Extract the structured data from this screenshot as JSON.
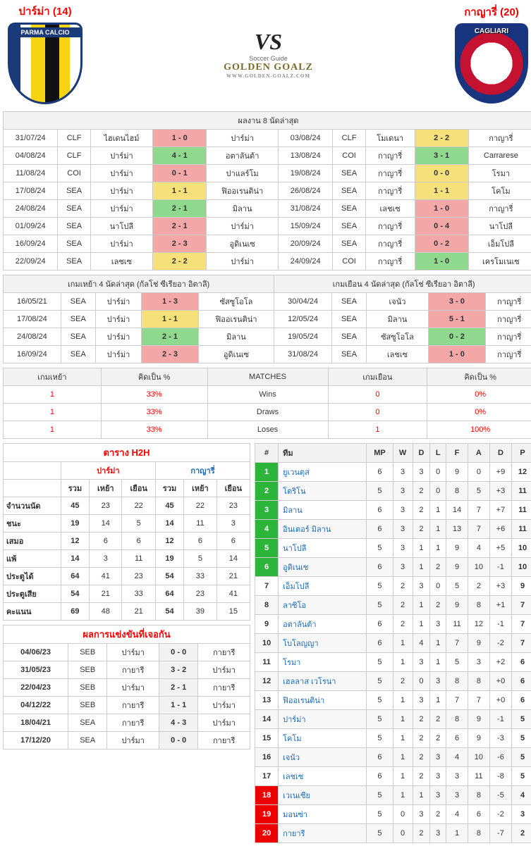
{
  "header": {
    "home": "ปาร์ม่า (14)",
    "away": "กาญารี่ (20)",
    "vs": "VS",
    "brand": "GOLDEN GOALZ",
    "brand_sub": "WWW.GOLDEN-GOALZ.COM",
    "brand_tag": "Soccer Guide",
    "parma_label": "PARMA CALCIO",
    "cagliari_label": "CAGLIARI"
  },
  "last8": {
    "title": "ผลงาน 8 นัดล่าสุด",
    "home": [
      {
        "d": "31/07/24",
        "c": "CLF",
        "h": "ไฮเดนไฮม์",
        "s": "1 - 0",
        "cls": "bg-red",
        "a": "ปาร์ม่า"
      },
      {
        "d": "04/08/24",
        "c": "CLF",
        "h": "ปาร์ม่า",
        "s": "4 - 1",
        "cls": "bg-green",
        "a": "อตาลันต้า"
      },
      {
        "d": "11/08/24",
        "c": "COI",
        "h": "ปาร์ม่า",
        "s": "0 - 1",
        "cls": "bg-red",
        "a": "ปาแลร์โม"
      },
      {
        "d": "17/08/24",
        "c": "SEA",
        "h": "ปาร์ม่า",
        "s": "1 - 1",
        "cls": "bg-yellow",
        "a": "ฟิออเรนติน่า"
      },
      {
        "d": "24/08/24",
        "c": "SEA",
        "h": "ปาร์ม่า",
        "s": "2 - 1",
        "cls": "bg-green",
        "a": "มิลาน"
      },
      {
        "d": "01/09/24",
        "c": "SEA",
        "h": "นาโปลี",
        "s": "2 - 1",
        "cls": "bg-red",
        "a": "ปาร์ม่า"
      },
      {
        "d": "16/09/24",
        "c": "SEA",
        "h": "ปาร์ม่า",
        "s": "2 - 3",
        "cls": "bg-red",
        "a": "อูดิเนเซ"
      },
      {
        "d": "22/09/24",
        "c": "SEA",
        "h": "เลชเซ",
        "s": "2 - 2",
        "cls": "bg-yellow",
        "a": "ปาร์ม่า"
      }
    ],
    "away": [
      {
        "d": "03/08/24",
        "c": "CLF",
        "h": "โมเดนา",
        "s": "2 - 2",
        "cls": "bg-yellow",
        "a": "กาญารี่"
      },
      {
        "d": "13/08/24",
        "c": "COI",
        "h": "กาญารี่",
        "s": "3 - 1",
        "cls": "bg-green",
        "a": "Carrarese"
      },
      {
        "d": "19/08/24",
        "c": "SEA",
        "h": "กาญารี่",
        "s": "0 - 0",
        "cls": "bg-yellow",
        "a": "โรมา"
      },
      {
        "d": "26/08/24",
        "c": "SEA",
        "h": "กาญารี่",
        "s": "1 - 1",
        "cls": "bg-yellow",
        "a": "โคโม"
      },
      {
        "d": "31/08/24",
        "c": "SEA",
        "h": "เลชเซ",
        "s": "1 - 0",
        "cls": "bg-red",
        "a": "กาญารี่"
      },
      {
        "d": "15/09/24",
        "c": "SEA",
        "h": "กาญารี่",
        "s": "0 - 4",
        "cls": "bg-red",
        "a": "นาโปลี"
      },
      {
        "d": "20/09/24",
        "c": "SEA",
        "h": "กาญารี่",
        "s": "0 - 2",
        "cls": "bg-red",
        "a": "เอ็มโปลี"
      },
      {
        "d": "24/09/24",
        "c": "COI",
        "h": "กาญารี่",
        "s": "1 - 0",
        "cls": "bg-green",
        "a": "เครโมเนเซ"
      }
    ]
  },
  "last4": {
    "home_title": "เกมเหย้า 4 นัดล่าสุด (กัลโช่ ซีเรียอา อิตาลี)",
    "away_title": "เกมเยือน 4 นัดล่าสุด (กัลโช่ ซีเรียอา อิตาลี)",
    "home": [
      {
        "d": "16/05/21",
        "c": "SEA",
        "h": "ปาร์ม่า",
        "s": "1 - 3",
        "cls": "bg-red",
        "a": "ซัสซูโอโล"
      },
      {
        "d": "17/08/24",
        "c": "SEA",
        "h": "ปาร์ม่า",
        "s": "1 - 1",
        "cls": "bg-yellow",
        "a": "ฟิออเรนติน่า"
      },
      {
        "d": "24/08/24",
        "c": "SEA",
        "h": "ปาร์ม่า",
        "s": "2 - 1",
        "cls": "bg-green",
        "a": "มิลาน"
      },
      {
        "d": "16/09/24",
        "c": "SEA",
        "h": "ปาร์ม่า",
        "s": "2 - 3",
        "cls": "bg-red",
        "a": "อูดิเนเซ"
      }
    ],
    "away": [
      {
        "d": "30/04/24",
        "c": "SEA",
        "h": "เจนัว",
        "s": "3 - 0",
        "cls": "bg-red",
        "a": "กาญารี่"
      },
      {
        "d": "12/05/24",
        "c": "SEA",
        "h": "มิลาน",
        "s": "5 - 1",
        "cls": "bg-red",
        "a": "กาญารี่"
      },
      {
        "d": "19/05/24",
        "c": "SEA",
        "h": "ซัสซูโอโล",
        "s": "0 - 2",
        "cls": "bg-green",
        "a": "กาญารี่"
      },
      {
        "d": "31/08/24",
        "c": "SEA",
        "h": "เลชเซ",
        "s": "1 - 0",
        "cls": "bg-red",
        "a": "กาญารี่"
      }
    ]
  },
  "summary": {
    "head": {
      "home_game": "เกมเหย้า",
      "pct": "คิดเป็น %",
      "matches": "MATCHES",
      "away_game": "เกมเยือน"
    },
    "rows": [
      {
        "hv": "1",
        "hp": "33%",
        "lbl": "Wins",
        "av": "0",
        "ap": "0%"
      },
      {
        "hv": "1",
        "hp": "33%",
        "lbl": "Draws",
        "av": "0",
        "ap": "0%"
      },
      {
        "hv": "1",
        "hp": "33%",
        "lbl": "Loses",
        "av": "1",
        "ap": "100%"
      }
    ]
  },
  "h2h": {
    "title": "ตาราง H2H",
    "home": "ปาร์ม่า",
    "away": "กาญารี่",
    "cols": {
      "c1": "รวม",
      "c2": "เหย้า",
      "c3": "เยือน"
    },
    "rows": [
      {
        "lbl": "จำนวนนัด",
        "h": [
          "45",
          "23",
          "22"
        ],
        "a": [
          "45",
          "22",
          "23"
        ]
      },
      {
        "lbl": "ชนะ",
        "h": [
          "19",
          "14",
          "5"
        ],
        "a": [
          "14",
          "11",
          "3"
        ]
      },
      {
        "lbl": "เสมอ",
        "h": [
          "12",
          "6",
          "6"
        ],
        "a": [
          "12",
          "6",
          "6"
        ]
      },
      {
        "lbl": "แพ้",
        "h": [
          "14",
          "3",
          "11"
        ],
        "a": [
          "19",
          "5",
          "14"
        ]
      },
      {
        "lbl": "ประตูได้",
        "h": [
          "64",
          "41",
          "23"
        ],
        "a": [
          "54",
          "33",
          "21"
        ]
      },
      {
        "lbl": "ประตูเสีย",
        "h": [
          "54",
          "21",
          "33"
        ],
        "a": [
          "64",
          "23",
          "41"
        ]
      },
      {
        "lbl": "คะแนน",
        "h": [
          "69",
          "48",
          "21"
        ],
        "a": [
          "54",
          "39",
          "15"
        ]
      }
    ]
  },
  "meetings": {
    "title": "ผลการแข่งขันที่เจอกัน",
    "rows": [
      {
        "d": "04/06/23",
        "c": "SEB",
        "h": "ปาร์มา",
        "s": "0 - 0",
        "a": "กายารี"
      },
      {
        "d": "31/05/23",
        "c": "SEB",
        "h": "กายารี",
        "s": "3 - 2",
        "a": "ปาร์มา"
      },
      {
        "d": "22/04/23",
        "c": "SEB",
        "h": "ปาร์มา",
        "s": "2 - 1",
        "a": "กายารี"
      },
      {
        "d": "04/12/22",
        "c": "SEB",
        "h": "กายารี",
        "s": "1 - 1",
        "a": "ปาร์มา"
      },
      {
        "d": "18/04/21",
        "c": "SEA",
        "h": "กายารี",
        "s": "4 - 3",
        "a": "ปาร์มา"
      },
      {
        "d": "17/12/20",
        "c": "SEA",
        "h": "ปาร์มา",
        "s": "0 - 0",
        "a": "กายารี"
      }
    ]
  },
  "standing": {
    "head": {
      "rank": "#",
      "team": "ทีม",
      "mp": "MP",
      "w": "W",
      "d": "D",
      "l": "L",
      "f": "F",
      "a": "A",
      "gd": "D",
      "p": "P"
    },
    "rows": [
      {
        "r": "1",
        "cls": "rank-green",
        "t": "ยูเวนตุส",
        "v": [
          "6",
          "3",
          "3",
          "0",
          "9",
          "0",
          "+9",
          "12"
        ]
      },
      {
        "r": "2",
        "cls": "rank-green",
        "t": "โตริโน",
        "v": [
          "5",
          "3",
          "2",
          "0",
          "8",
          "5",
          "+3",
          "11"
        ]
      },
      {
        "r": "3",
        "cls": "rank-green",
        "t": "มิลาน",
        "v": [
          "6",
          "3",
          "2",
          "1",
          "14",
          "7",
          "+7",
          "11"
        ]
      },
      {
        "r": "4",
        "cls": "rank-green",
        "t": "อินเตอร์ มิลาน",
        "v": [
          "6",
          "3",
          "2",
          "1",
          "13",
          "7",
          "+6",
          "11"
        ]
      },
      {
        "r": "5",
        "cls": "rank-green",
        "t": "นาโปลี",
        "v": [
          "5",
          "3",
          "1",
          "1",
          "9",
          "4",
          "+5",
          "10"
        ]
      },
      {
        "r": "6",
        "cls": "rank-green",
        "t": "อูดิเนเซ",
        "v": [
          "6",
          "3",
          "1",
          "2",
          "9",
          "10",
          "-1",
          "10"
        ]
      },
      {
        "r": "7",
        "cls": "",
        "t": "เอ็มโปลี",
        "v": [
          "5",
          "2",
          "3",
          "0",
          "5",
          "2",
          "+3",
          "9"
        ]
      },
      {
        "r": "8",
        "cls": "",
        "t": "ลาซิโอ",
        "v": [
          "5",
          "2",
          "1",
          "2",
          "9",
          "8",
          "+1",
          "7"
        ]
      },
      {
        "r": "9",
        "cls": "",
        "t": "อตาลันต้า",
        "v": [
          "6",
          "2",
          "1",
          "3",
          "11",
          "12",
          "-1",
          "7"
        ]
      },
      {
        "r": "10",
        "cls": "",
        "t": "โบโลญญา",
        "v": [
          "6",
          "1",
          "4",
          "1",
          "7",
          "9",
          "-2",
          "7"
        ]
      },
      {
        "r": "11",
        "cls": "",
        "t": "โรมา",
        "v": [
          "5",
          "1",
          "3",
          "1",
          "5",
          "3",
          "+2",
          "6"
        ]
      },
      {
        "r": "12",
        "cls": "",
        "t": "เฮลลาส เวโรนา",
        "v": [
          "5",
          "2",
          "0",
          "3",
          "8",
          "8",
          "+0",
          "6"
        ]
      },
      {
        "r": "13",
        "cls": "",
        "t": "ฟิออเรนติน่า",
        "v": [
          "5",
          "1",
          "3",
          "1",
          "7",
          "7",
          "+0",
          "6"
        ]
      },
      {
        "r": "14",
        "cls": "",
        "t": "ปาร์ม่า",
        "v": [
          "5",
          "1",
          "2",
          "2",
          "8",
          "9",
          "-1",
          "5"
        ]
      },
      {
        "r": "15",
        "cls": "",
        "t": "โคโม",
        "v": [
          "5",
          "1",
          "2",
          "2",
          "6",
          "9",
          "-3",
          "5"
        ]
      },
      {
        "r": "16",
        "cls": "",
        "t": "เจนัว",
        "v": [
          "6",
          "1",
          "2",
          "3",
          "4",
          "10",
          "-6",
          "5"
        ]
      },
      {
        "r": "17",
        "cls": "",
        "t": "เลชเซ",
        "v": [
          "6",
          "1",
          "2",
          "3",
          "3",
          "11",
          "-8",
          "5"
        ]
      },
      {
        "r": "18",
        "cls": "rank-red",
        "t": "เวเนเซีย",
        "v": [
          "5",
          "1",
          "1",
          "3",
          "3",
          "8",
          "-5",
          "4"
        ]
      },
      {
        "r": "19",
        "cls": "rank-red",
        "t": "มอนซ่า",
        "v": [
          "5",
          "0",
          "3",
          "2",
          "4",
          "6",
          "-2",
          "3"
        ]
      },
      {
        "r": "20",
        "cls": "rank-red",
        "t": "กายารี",
        "v": [
          "5",
          "0",
          "2",
          "3",
          "1",
          "8",
          "-7",
          "2"
        ]
      }
    ]
  }
}
